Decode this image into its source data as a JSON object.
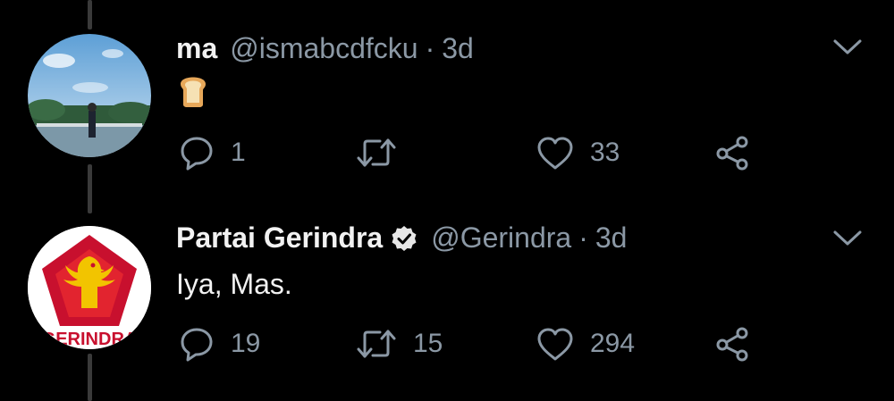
{
  "tweets": [
    {
      "name": "ma",
      "handle": "@ismabcdfcku",
      "separator": "·",
      "time": "3d",
      "verified": false,
      "body_emoji": "bread-emoji",
      "actions": {
        "reply_count": "1",
        "retweet_count": "",
        "like_count": "33"
      }
    },
    {
      "name": "Partai Gerindra",
      "handle": "@Gerindra",
      "separator": "·",
      "time": "3d",
      "verified": true,
      "body_text": "Iya, Mas.",
      "avatar_logo_text": "GERINDRA",
      "actions": {
        "reply_count": "19",
        "retweet_count": "15",
        "like_count": "294"
      }
    }
  ],
  "icons": [
    "reply-icon",
    "retweet-icon",
    "like-icon",
    "share-icon",
    "chevron-down-icon",
    "verified-badge-icon"
  ],
  "colors": {
    "background": "#000000",
    "secondary_text": "#8b98a5",
    "gerindra_red": "#c8102e",
    "gerindra_gold": "#f2c400"
  }
}
